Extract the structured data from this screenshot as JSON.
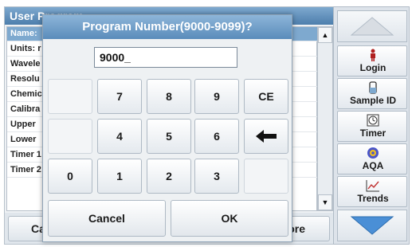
{
  "background": {
    "title": "User Program",
    "rows": [
      "Name:",
      "Units: r",
      "Wavele",
      "Resolu",
      "Chemic",
      "Calibra",
      "Upper",
      "Lower",
      "Timer 1",
      "Timer 2"
    ],
    "bottom_left_label": "Ca",
    "bottom_right_label": "ore"
  },
  "sidebar": {
    "items": [
      {
        "label": "Login",
        "icon": "person-icon"
      },
      {
        "label": "Sample ID",
        "icon": "vial-icon"
      },
      {
        "label": "Timer",
        "icon": "clock-icon"
      },
      {
        "label": "AQA",
        "icon": "aqa-icon"
      },
      {
        "label": "Trends",
        "icon": "trend-chart-icon"
      }
    ]
  },
  "dialog": {
    "title": "Program Number(9000-9099)?",
    "input_value": "9000_",
    "keys": {
      "k7": "7",
      "k8": "8",
      "k9": "9",
      "ce": "CE",
      "k4": "4",
      "k5": "5",
      "k6": "6",
      "k0": "0",
      "k1": "1",
      "k2": "2",
      "k3": "3"
    },
    "cancel_label": "Cancel",
    "ok_label": "OK"
  },
  "colors": {
    "title_bar": "#5a8cbb",
    "highlight": "#7ea9cf",
    "arrow_blue": "#4a8fd6"
  }
}
